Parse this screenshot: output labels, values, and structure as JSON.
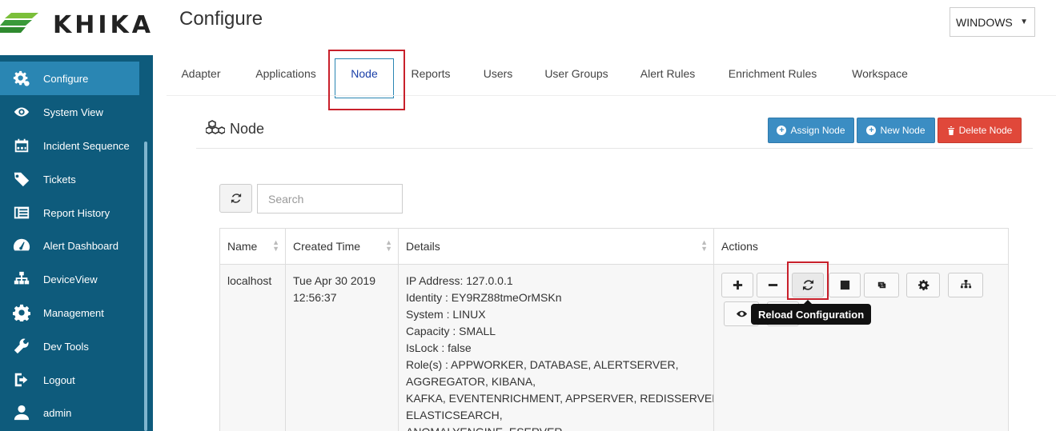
{
  "app": {
    "logo_text": "KHIKA",
    "brand_color": "#0e5b7c",
    "accent": "#2a86b3"
  },
  "header": {
    "title": "Configure",
    "os_select_value": "WINDOWS"
  },
  "sidebar": {
    "items": [
      {
        "label": "Configure",
        "icon": "gear-icon",
        "active": true
      },
      {
        "label": "System View",
        "icon": "eye-icon"
      },
      {
        "label": "Incident Sequence",
        "icon": "calendar-icon"
      },
      {
        "label": "Tickets",
        "icon": "tag-icon"
      },
      {
        "label": "Report History",
        "icon": "list-icon"
      },
      {
        "label": "Alert Dashboard",
        "icon": "dashboard-icon"
      },
      {
        "label": "DeviceView",
        "icon": "sitemap-icon"
      },
      {
        "label": "Management",
        "icon": "gear-icon"
      },
      {
        "label": "Dev Tools",
        "icon": "wrench-icon"
      },
      {
        "label": "Logout",
        "icon": "logout-icon"
      },
      {
        "label": "admin",
        "icon": "user-icon"
      }
    ]
  },
  "tabs": [
    {
      "label": "Adapter"
    },
    {
      "label": "Applications"
    },
    {
      "label": "Node",
      "active": true
    },
    {
      "label": "Reports"
    },
    {
      "label": "Users"
    },
    {
      "label": "User Groups"
    },
    {
      "label": "Alert Rules"
    },
    {
      "label": "Enrichment Rules"
    },
    {
      "label": "Workspace"
    }
  ],
  "section": {
    "title": "Node",
    "assign_label": "Assign Node",
    "new_label": "New Node",
    "delete_label": "Delete Node"
  },
  "search": {
    "placeholder": "Search",
    "value": ""
  },
  "table": {
    "headers": [
      "Name",
      "Created Time",
      "Details",
      "Actions"
    ],
    "rows": [
      {
        "name": "localhost",
        "created": "Tue Apr 30 2019 12:56:37",
        "details": [
          "IP Address: 127.0.0.1",
          "Identity : EY9RZ88tmeOrMSKn",
          "System : LINUX",
          "Capacity : SMALL",
          "IsLock : false",
          "Role(s) : APPWORKER, DATABASE, ALERTSERVER,",
          "AGGREGATOR, KIBANA,",
          "KAFKA, EVENTENRICHMENT, APPSERVER, REDISSERVER,",
          "ELASTICSEARCH,",
          "ANOMALYENGINE, ESERVER"
        ]
      }
    ]
  },
  "actions": [
    {
      "icon": "plus-icon"
    },
    {
      "icon": "minus-icon"
    },
    {
      "icon": "reload-icon"
    },
    {
      "icon": "share-icon"
    },
    {
      "icon": "retweet-icon"
    },
    {
      "icon": "gear-icon"
    },
    {
      "icon": "sitemap-icon"
    },
    {
      "icon": "eye-icon"
    }
  ],
  "tooltip": "Reload Configuration"
}
